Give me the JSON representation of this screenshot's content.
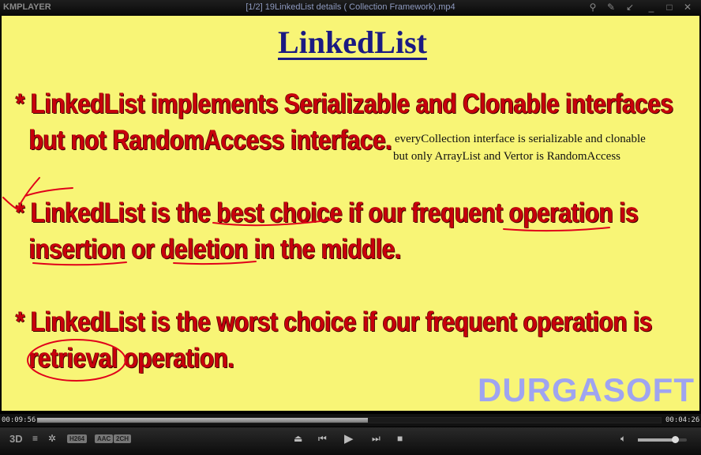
{
  "app": {
    "logo": "KMPLAYER",
    "title": "[1/2] 19LinkedList details ( Collection Framework).mp4"
  },
  "window_buttons": [
    "search-icon",
    "pin-icon",
    "minimize-to-corner-icon",
    "minimize-icon",
    "maximize-icon",
    "close-icon"
  ],
  "slide": {
    "title": "LinkedList",
    "bullet1": [
      "* LinkedList implements Serializable and Clonable interfaces",
      "but not RandomAccess interface."
    ],
    "note": [
      "everyCollection interface is serializable and clonable",
      "but only ArrayList and Vertor is RandomAccess"
    ],
    "bullet2": [
      "* LinkedList is the best choice if our frequent operation is",
      "insertion or deletion in the middle."
    ],
    "bullet3": [
      "* LinkedList is the worst choice if our frequent operation is",
      "retrieval operation."
    ],
    "watermark": "DURGASOFT",
    "colors": {
      "background": "#f8f576",
      "text": "#c8000c",
      "title": "#1b1a82",
      "ink": "#e0001a",
      "watermark": "#9fa4f0"
    }
  },
  "player": {
    "elapsed": "00:09:56",
    "remaining": "00:04:26",
    "progress": 0.53,
    "badges": [
      "H264",
      "AAC",
      "2CH"
    ],
    "volume": 0.75
  }
}
